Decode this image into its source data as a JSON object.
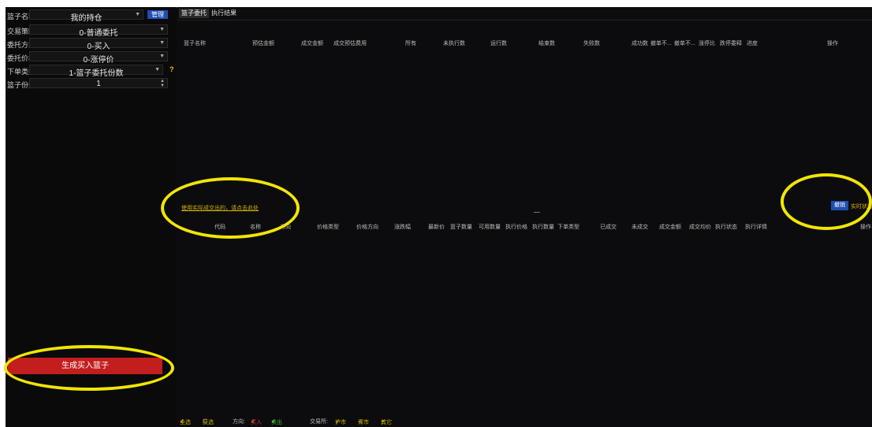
{
  "left_panel": {
    "rows": [
      {
        "label": "篮子名称",
        "value": "我的持仓"
      },
      {
        "label": "交易策略",
        "value": "0-普通委托"
      },
      {
        "label": "委托方向",
        "value": "0-买入"
      },
      {
        "label": "委托价格",
        "value": "0-涨停价"
      },
      {
        "label": "下单类型",
        "value": "1-篮子委托份数"
      },
      {
        "label": "篮子份数",
        "value": "1"
      }
    ],
    "manage_label": "管理",
    "help_label": "?",
    "generate_button": "生成买入篮子"
  },
  "tabs": [
    "篮子委托",
    "执行结果"
  ],
  "top_table": {
    "headers": [
      "篮子名称",
      "预估金额",
      "成交金额",
      "成交预估费用",
      "所有",
      "未执行数",
      "运行数",
      "结束数",
      "失败数",
      "成功数",
      "撤单不...",
      "撤单不...",
      "涨停比",
      "跌停委释",
      "进度",
      "操作"
    ]
  },
  "middle": {
    "link_text": "使用实际成交出的，请点击此处",
    "blue_button": "撤销",
    "link_right": "实时状态"
  },
  "bottom_table": {
    "headers": [
      "代码",
      "名称",
      "方向",
      "价格类型",
      "价格方向",
      "涨跌幅",
      "最新价",
      "篮子数量",
      "可用数量",
      "执行价格",
      "执行数量",
      "下单类型",
      "已成交",
      "未成交",
      "成交金额",
      "成交均价",
      "执行状态",
      "执行详情",
      "操作"
    ]
  },
  "footer": {
    "items": [
      "全选",
      "反选",
      "方向:",
      "买入",
      "卖出",
      "交易所:",
      "沪市",
      "深市",
      "其它"
    ]
  }
}
